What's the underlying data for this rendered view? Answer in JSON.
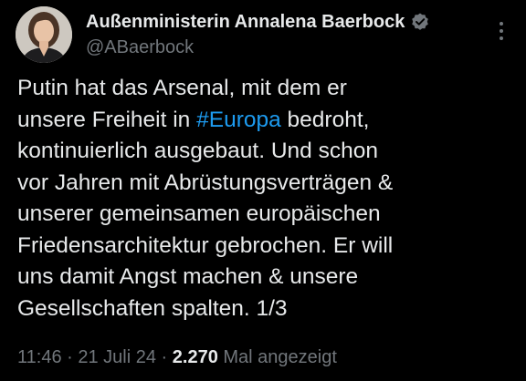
{
  "author": {
    "display_name": "Außenministerin Annalena Baerbock",
    "handle": "@ABaerbock",
    "verified": true,
    "verified_color": "#71767b"
  },
  "tweet": {
    "lines": [
      {
        "before": "Putin hat das Arsenal, mit dem er",
        "hashtag": "",
        "after": ""
      },
      {
        "before": "unsere Freiheit in ",
        "hashtag": "#Europa",
        "after": " bedroht,"
      },
      {
        "before": "kontinuierlich ausgebaut. Und schon",
        "hashtag": "",
        "after": ""
      },
      {
        "before": "vor Jahren mit Abrüstungsverträgen &",
        "hashtag": "",
        "after": ""
      },
      {
        "before": "unserer gemeinsamen europäischen",
        "hashtag": "",
        "after": ""
      },
      {
        "before": "Friedensarchitektur gebrochen. Er will",
        "hashtag": "",
        "after": ""
      },
      {
        "before": "uns damit Angst machen & unsere",
        "hashtag": "",
        "after": ""
      },
      {
        "before": "Gesellschaften spalten. 1/3",
        "hashtag": "",
        "after": ""
      }
    ]
  },
  "meta": {
    "time": "11:46",
    "separator1": " · ",
    "date": "21 Juli 24",
    "separator2": " · ",
    "views_count": "2.270",
    "views_label": " Mal angezeigt"
  },
  "icons": {
    "more": "more-vertical-icon",
    "verified": "verified-badge-icon"
  },
  "colors": {
    "background": "#000000",
    "text": "#e7e9ea",
    "secondary": "#71767b",
    "link": "#1d9bf0"
  }
}
